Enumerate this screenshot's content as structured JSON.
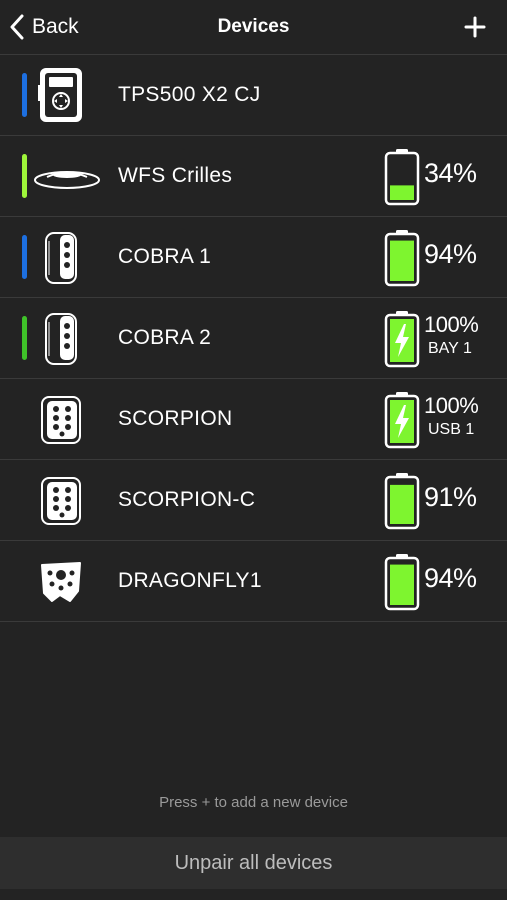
{
  "header": {
    "back_label": "Back",
    "title": "Devices",
    "add_icon": "plus-icon"
  },
  "colors": {
    "background": "#232323",
    "separator": "#3a3a3a",
    "battery_fill": "#7ef52f",
    "blue_indicator": "#1d6fe0",
    "green_indicator": "#4fd92a"
  },
  "devices": [
    {
      "name": "TPS500 X2 CJ",
      "indicator": "blue",
      "icon": "controller-icon",
      "battery": null,
      "percent": "",
      "sub": ""
    },
    {
      "name": "WFS Crilles",
      "indicator": "lime",
      "icon": "disc-sensor-icon",
      "battery": 0.34,
      "charging": false,
      "percent": "34%",
      "sub": ""
    },
    {
      "name": "COBRA 1",
      "indicator": "blue",
      "icon": "cylinder-device-icon",
      "battery": 0.94,
      "charging": false,
      "percent": "94%",
      "sub": ""
    },
    {
      "name": "COBRA 2",
      "indicator": "green",
      "icon": "cylinder-device-icon",
      "battery": 1.0,
      "charging": true,
      "percent": "100%",
      "sub": "BAY 1"
    },
    {
      "name": "SCORPION",
      "indicator": "none",
      "icon": "keypad-device-icon",
      "battery": 1.0,
      "charging": true,
      "percent": "100%",
      "sub": "USB 1"
    },
    {
      "name": "SCORPION-C",
      "indicator": "none",
      "icon": "keypad-device-icon",
      "battery": 0.91,
      "charging": false,
      "percent": "91%",
      "sub": ""
    },
    {
      "name": "DRAGONFLY1",
      "indicator": "none",
      "icon": "dragonfly-device-icon",
      "battery": 0.94,
      "charging": false,
      "percent": "94%",
      "sub": ""
    }
  ],
  "footer": {
    "hint": "Press + to add a new device",
    "unpair_label": "Unpair all devices"
  }
}
